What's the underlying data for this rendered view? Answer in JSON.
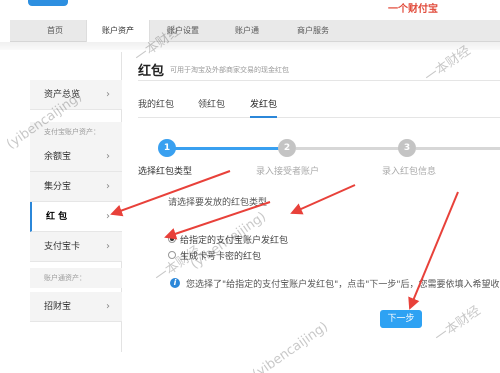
{
  "topbar": {
    "brand": "一个财付宝"
  },
  "nav": {
    "items": [
      {
        "label": "首页"
      },
      {
        "label": "账户资产"
      },
      {
        "label": "账户设置"
      },
      {
        "label": "账户通"
      },
      {
        "label": "商户服务"
      }
    ],
    "active_index": 1
  },
  "sidebar": {
    "items": [
      {
        "label": "资产总览"
      },
      {
        "label": "支付宝账户资产："
      },
      {
        "label": "余额宝"
      },
      {
        "label": "集分宝"
      },
      {
        "label": "红 包"
      },
      {
        "label": "支付宝卡"
      },
      {
        "label": "账户通资产："
      },
      {
        "label": "招财宝"
      }
    ],
    "chevron": "›",
    "active_label": "红 包"
  },
  "main": {
    "title": "红包",
    "subtitle": "可用于淘宝及外部商家交易的现金红包",
    "tabs": [
      {
        "label": "我的红包"
      },
      {
        "label": "领红包"
      },
      {
        "label": "发红包"
      }
    ],
    "active_tab": "发红包",
    "steps": [
      {
        "num": "1",
        "label": "选择红包类型"
      },
      {
        "num": "2",
        "label": "录入接受者账户"
      },
      {
        "num": "3",
        "label": "录入红包信息"
      }
    ],
    "choose_label": "请选择要发放的红包类型",
    "options": [
      {
        "text": "给指定的支付宝账户发红包",
        "checked": true
      },
      {
        "text": "生成卡号卡密的红包",
        "checked": false
      }
    ],
    "info_icon": "i",
    "info_text": "您选择了\"给指定的支付宝账户发红包\"，点击\"下一步\"后，您需要依填入希望收到",
    "next_button": "下一步"
  },
  "watermark": {
    "chinese": "一本财经",
    "latin": "(yibencaijing)"
  },
  "colors": {
    "accent": "#2b87d9",
    "button": "#2ea2f3",
    "step_active": "#39a0f0",
    "arrow": "#e8413a"
  }
}
